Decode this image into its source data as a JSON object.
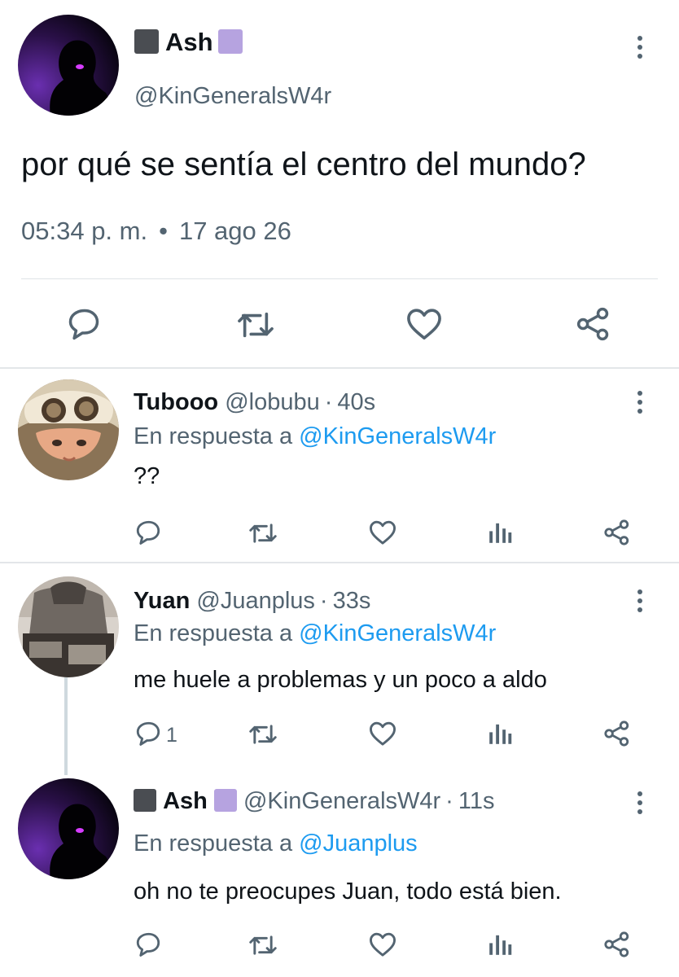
{
  "main_tweet": {
    "display_name": "Ash",
    "handle": "@KinGeneralsW4r",
    "text": "por qué se sentía el centro del mundo?",
    "time": "05:34 p. m.",
    "separator": "•",
    "date": "17 ago 26"
  },
  "replies": [
    {
      "display_name": "Tubooo",
      "handle": "@lobubu",
      "separator": "·",
      "age": "40s",
      "reply_prefix": "En respuesta a",
      "reply_to": "@KinGeneralsW4r",
      "text": "??",
      "reply_count": ""
    },
    {
      "display_name": "Yuan",
      "handle": "@Juanplus",
      "separator": "·",
      "age": "33s",
      "reply_prefix": "En respuesta a",
      "reply_to": "@KinGeneralsW4r",
      "text": "me huele a problemas y un poco a aldo",
      "reply_count": "1"
    },
    {
      "display_name": "Ash",
      "handle": "@KinGeneralsW4r",
      "separator": "·",
      "age": "11s",
      "reply_prefix": "En respuesta a",
      "reply_to": "@Juanplus",
      "text": "oh no te preocupes Juan, todo está bien.",
      "reply_count": ""
    }
  ],
  "colors": {
    "text": "#0f1419",
    "secondary": "#536471",
    "mention": "#1d9bf0",
    "badge_dark": "#4a4d52",
    "badge_lavender": "#b6a3e0"
  }
}
